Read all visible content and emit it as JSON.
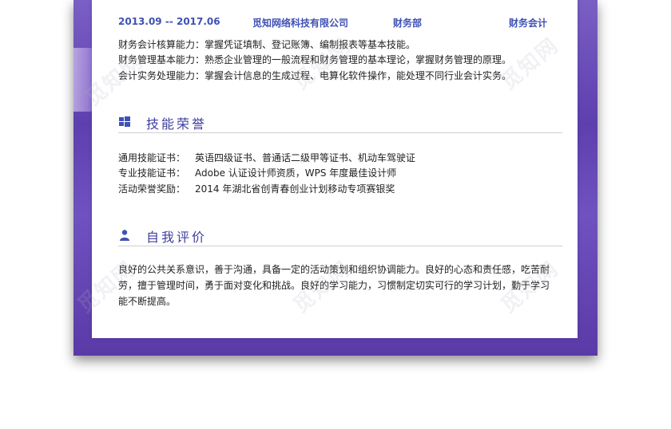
{
  "job": {
    "period": "2013.09 -- 2017.06",
    "company": "觅知网络科技有限公司",
    "department": "财务部",
    "title": "财务会计"
  },
  "duties": [
    "财务会计核算能力：掌握凭证填制、登记账簿、编制报表等基本技能。",
    "财务管理基本能力：熟悉企业管理的一般流程和财务管理的基本理论，掌握财务管理的原理。",
    "会计实务处理能力：掌握会计信息的生成过程、电算化软件操作，能处理不同行业会计实务。"
  ],
  "skills": {
    "heading": "技能荣誉",
    "icon": "windows-icon",
    "rows": [
      {
        "label": "通用技能证书：",
        "value": "英语四级证书、普通话二级甲等证书、机动车驾驶证"
      },
      {
        "label": "专业技能证书：",
        "value": "Adobe 认证设计师资质，WPS 年度最佳设计师"
      },
      {
        "label": "活动荣誉奖励：",
        "value": "2014 年湖北省创青春创业计划移动专项赛银奖"
      }
    ]
  },
  "self_eval": {
    "heading": "自我评价",
    "icon": "person-icon",
    "lines": [
      "良好的公共关系意识，善于沟通，具备一定的活动策划和组织协调能力。良好的心态和责任感，吃苦耐",
      "劳，擅于管理时间，勇于面对变化和挑战。良好的学习能力，习惯制定切实可行的学习计划，勤于学习",
      "能不断提高。"
    ]
  },
  "watermark": "觅知网",
  "colors": {
    "accent": "#3f51b5",
    "heading": "#3f3f9f",
    "frame": "#6a4fbd"
  }
}
